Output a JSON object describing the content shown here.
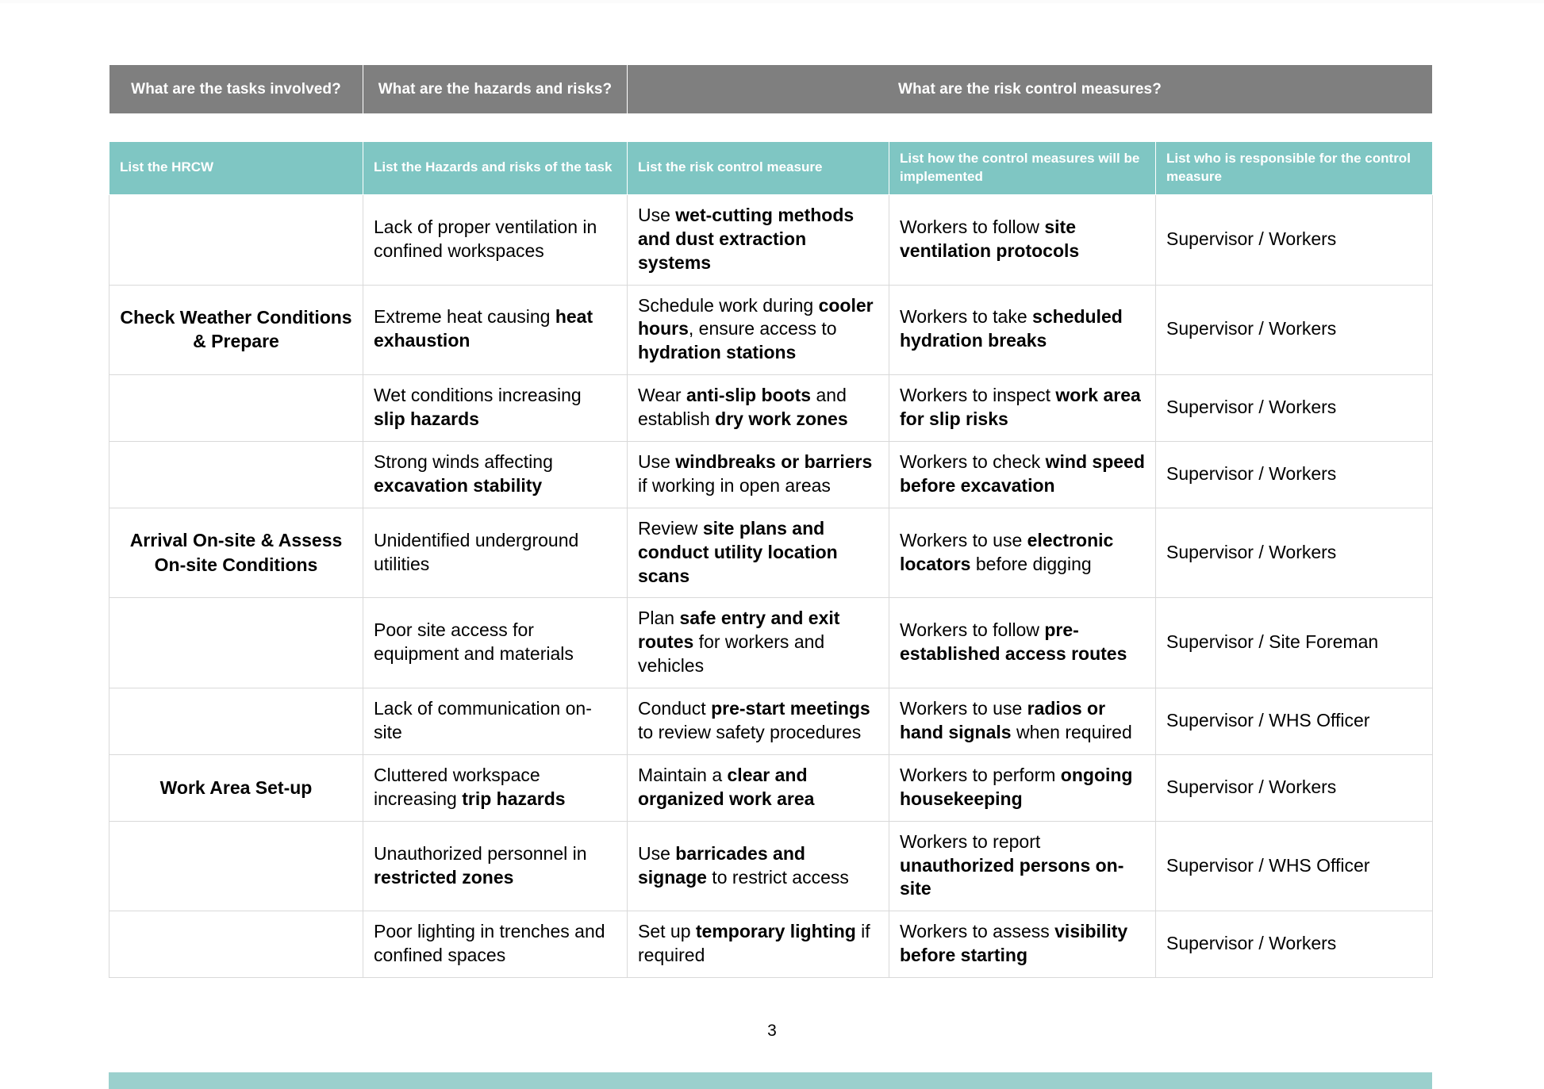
{
  "document": {
    "page_number": "3",
    "colors": {
      "banner_background": "#7f7f7f",
      "header_background": "#7fc6c3",
      "bottom_bar": "#9bd0cd",
      "grid_line": "#d9d9d9",
      "text": "#000000",
      "header_text": "#ffffff"
    }
  },
  "banner": {
    "columns": [
      "What are the tasks involved?",
      "What are the hazards and risks?",
      "What are the risk control measures?"
    ]
  },
  "table": {
    "headers": [
      "List the HRCW",
      "List the Hazards and risks of the task",
      "List the risk control measure",
      "List how the control measures will be implemented",
      "List who is responsible for the control measure"
    ],
    "rows": [
      {
        "task": "",
        "hazard_html": "Lack of proper ventilation in confined workspaces",
        "control_html": "Use <b>wet-cutting methods and dust extraction systems</b>",
        "implementation_html": "Workers to follow <b>site ventilation protocols</b>",
        "responsible": "Supervisor / Workers"
      },
      {
        "task": "Check Weather Conditions &amp; Prepare",
        "hazard_html": "Extreme heat causing <b>heat exhaustion</b>",
        "control_html": "Schedule work during <b>cooler hours</b>, ensure access to <b>hydration stations</b>",
        "implementation_html": "Workers to take <b>scheduled hydration breaks</b>",
        "responsible": "Supervisor / Workers"
      },
      {
        "task": "",
        "hazard_html": "Wet conditions increasing <b>slip hazards</b>",
        "control_html": "Wear <b>anti-slip boots</b> and establish <b>dry work zones</b>",
        "implementation_html": "Workers to inspect <b>work area for slip risks</b>",
        "responsible": "Supervisor / Workers"
      },
      {
        "task": "",
        "hazard_html": "Strong winds affecting <b>excavation stability</b>",
        "control_html": "Use <b>windbreaks or barriers</b> if working in open areas",
        "implementation_html": "Workers to check <b>wind speed before excavation</b>",
        "responsible": "Supervisor / Workers"
      },
      {
        "task": "Arrival On-site &amp; Assess On-site Conditions",
        "hazard_html": "Unidentified underground utilities",
        "control_html": "Review <b>site plans and conduct utility location scans</b>",
        "implementation_html": "Workers to use <b>electronic locators</b> before digging",
        "responsible": "Supervisor / Workers"
      },
      {
        "task": "",
        "hazard_html": "Poor site access for equipment and materials",
        "control_html": "Plan <b>safe entry and exit routes</b> for workers and vehicles",
        "implementation_html": "Workers to follow <b>pre-established access routes</b>",
        "responsible": "Supervisor / Site Foreman"
      },
      {
        "task": "",
        "hazard_html": "Lack of communication on-site",
        "control_html": "Conduct <b>pre-start meetings</b> to review safety procedures",
        "implementation_html": "Workers to use <b>radios or hand signals</b> when required",
        "responsible": "Supervisor / WHS Officer"
      },
      {
        "task": "Work Area Set-up",
        "hazard_html": "Cluttered workspace increasing <b>trip hazards</b>",
        "control_html": "Maintain a <b>clear and organized work area</b>",
        "implementation_html": "Workers to perform <b>ongoing housekeeping</b>",
        "responsible": "Supervisor / Workers"
      },
      {
        "task": "",
        "hazard_html": "Unauthorized personnel in <b>restricted zones</b>",
        "control_html": "Use <b>barricades and signage</b> to restrict access",
        "implementation_html": "Workers to report <b>unauthorized persons on-site</b>",
        "responsible": "Supervisor / WHS Officer"
      },
      {
        "task": "",
        "hazard_html": "Poor lighting in trenches and confined spaces",
        "control_html": "Set up <b>temporary lighting</b> if required",
        "implementation_html": "Workers to assess <b>visibility before starting</b>",
        "responsible": "Supervisor / Workers"
      }
    ]
  }
}
